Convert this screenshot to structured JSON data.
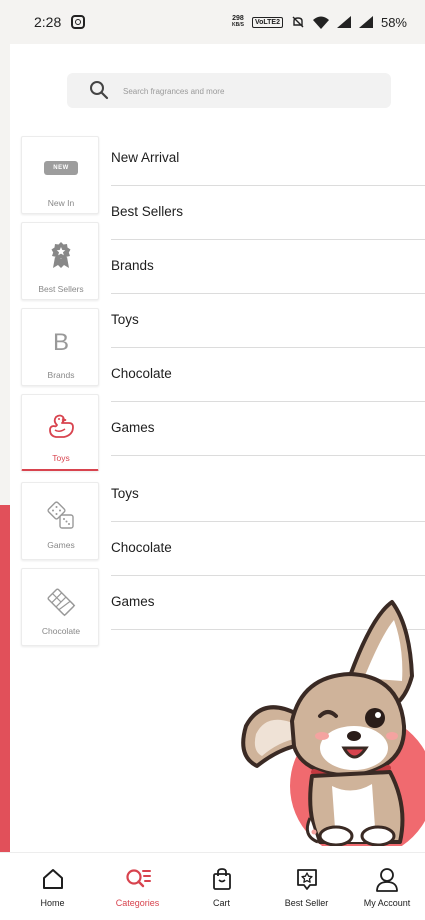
{
  "status": {
    "time": "2:28",
    "speed_value": "298",
    "speed_unit": "KB/S",
    "volte": "VoLTE2",
    "battery": "58%"
  },
  "search": {
    "placeholder": "Search fragrances and more"
  },
  "tiles": [
    {
      "label": "New In",
      "badge": "NEW",
      "icon": "new-badge-icon"
    },
    {
      "label": "Best Sellers",
      "icon": "award-badge-icon"
    },
    {
      "label": "Brands",
      "letter": "B",
      "icon": "letter-b-icon"
    },
    {
      "label": "Toys",
      "icon": "rubber-duck-icon",
      "active": true
    },
    {
      "label": "Games",
      "icon": "dice-icon"
    },
    {
      "label": "Chocolate",
      "icon": "chocolate-bar-icon"
    }
  ],
  "list": [
    "New Arrival",
    "Best Sellers",
    "Brands",
    "Toys",
    "Chocolate",
    "Games",
    "Toys",
    "Chocolate",
    "Games"
  ],
  "nav": [
    {
      "label": "Home",
      "icon": "home-icon"
    },
    {
      "label": "Categories",
      "icon": "categories-icon",
      "active": true
    },
    {
      "label": "Cart",
      "icon": "shopping-bag-icon"
    },
    {
      "label": "Best Seller",
      "icon": "star-badge-icon"
    },
    {
      "label": "My Account",
      "icon": "user-icon"
    }
  ],
  "colors": {
    "accent": "#d8434e",
    "strip": "#e1505a",
    "dog_circle": "#f06a6f"
  }
}
